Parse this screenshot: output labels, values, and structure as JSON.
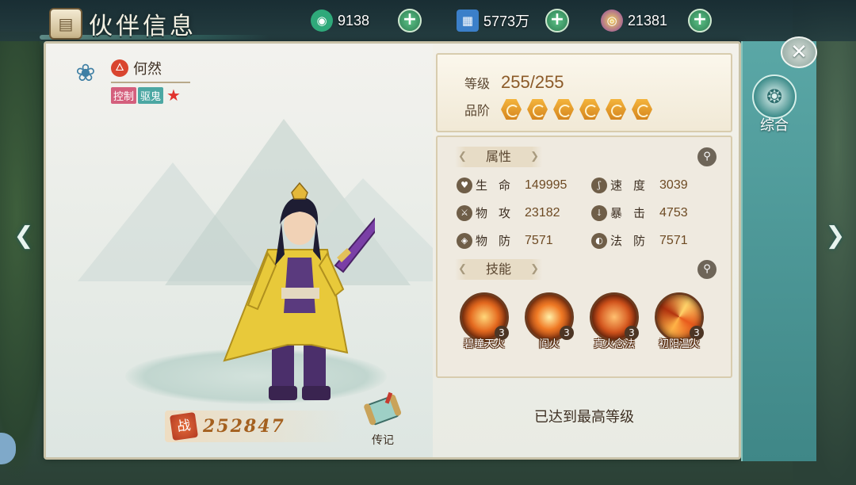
{
  "header": {
    "title": "伙伴信息",
    "resources": [
      {
        "name": "jade",
        "icon": "jade-coin-icon",
        "value": "9138",
        "color": "#2fa97a"
      },
      {
        "name": "silver",
        "icon": "book-icon",
        "value": "5773万",
        "color": "#3b7fc9"
      },
      {
        "name": "gold",
        "icon": "gem-icon",
        "value": "21381",
        "color": "#c98a2a"
      }
    ]
  },
  "hero": {
    "name": "何然",
    "tags": [
      "控制",
      "驱鬼"
    ],
    "power": "252847",
    "power_label": "战",
    "bio_label": "传记"
  },
  "level_card": {
    "level_label": "等级",
    "level_value": "255/255",
    "grade_label": "品阶",
    "grade_count": 6
  },
  "attributes": {
    "title": "属性",
    "items": [
      {
        "name": "生命",
        "icon": "heart-icon",
        "value": "149995"
      },
      {
        "name": "速度",
        "icon": "boot-icon",
        "value": "3039"
      },
      {
        "name": "物攻",
        "icon": "sword-icon",
        "value": "23182"
      },
      {
        "name": "暴击",
        "icon": "crit-icon",
        "value": "4753"
      },
      {
        "name": "物防",
        "icon": "shield-icon",
        "value": "7571"
      },
      {
        "name": "法防",
        "icon": "magic-shield-icon",
        "value": "7571"
      }
    ]
  },
  "skills": {
    "title": "技能",
    "items": [
      {
        "name": "碧瞳天火",
        "level": "3"
      },
      {
        "name": "阎火",
        "level": "3"
      },
      {
        "name": "真火念法",
        "level": "3"
      },
      {
        "name": "初阳温火",
        "level": "3"
      }
    ]
  },
  "status": {
    "max_level_text": "已达到最高等级"
  },
  "side": {
    "tab_label": "综合"
  }
}
